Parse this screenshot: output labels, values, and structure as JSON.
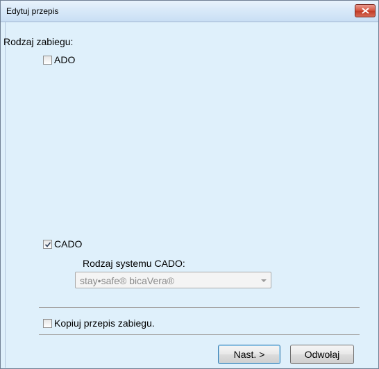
{
  "window": {
    "title": "Edytuj przepis"
  },
  "form": {
    "treatment_type_label": "Rodzaj zabiegu:",
    "ado": {
      "label": "ADO",
      "checked": false
    },
    "cado": {
      "label": "CADO",
      "checked": true
    },
    "cado_system_label": "Rodzaj systemu CADO:",
    "cado_system_value": "stay•safe® bicaVera®",
    "copy": {
      "label": "Kopiuj przepis zabiegu.",
      "checked": false
    }
  },
  "buttons": {
    "next": "Nast. >",
    "cancel": "Odwołaj"
  },
  "icons": {
    "close": "close-icon",
    "checkmark": "checkmark-icon",
    "dropdown": "chevron-down-icon"
  }
}
